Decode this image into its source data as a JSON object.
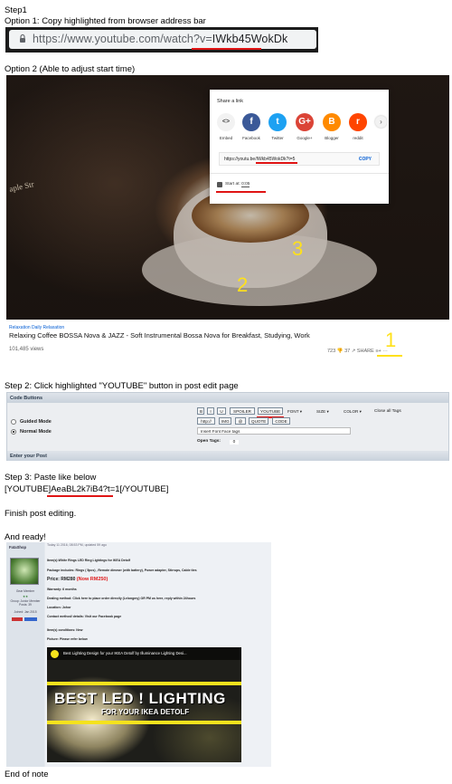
{
  "steps": {
    "step1": "Step1",
    "option1": "Option 1: Copy highlighted from browser address bar",
    "option2": "Option 2 (Able to adjust start time)",
    "step2": "Step 2: Click highlighted \"YOUTUBE\" button in post edit page",
    "step3": "Step 3: Paste like below",
    "paste_prefix": "[YOUTUBE]",
    "paste_id": "AeaBL2k7iB4?t=1",
    "paste_suffix": "[/YOUTUBE]",
    "finish": "Finish post editing.",
    "ready": "And ready!",
    "end": "End of note"
  },
  "addressbar": {
    "url_prefix": "https://www.youtube.com/watch?v=",
    "url_id": "IWkb45WokDk"
  },
  "video1": {
    "subtitle": "Relaxation Daily Relaxation",
    "title": "Relaxing Coffee BOSSA Nova & JAZZ - Soft Instrumental Bossa Nova for Breakfast, Studying, Work",
    "views": "101,485 views",
    "likes": "723   👎 37   ↗ SHARE   ≡+   ···",
    "overlay_text": "aple Str"
  },
  "share": {
    "title": "Share a link",
    "targets": [
      {
        "label": "Embed",
        "glyph": "<>",
        "color": "#f2f2f2"
      },
      {
        "label": "Facebook",
        "glyph": "f",
        "color": "#3b5998"
      },
      {
        "label": "Twitter",
        "glyph": "t",
        "color": "#1da1f2"
      },
      {
        "label": "Google+",
        "glyph": "G+",
        "color": "#db4437"
      },
      {
        "label": "Blogger",
        "glyph": "B",
        "color": "#ff8a00"
      },
      {
        "label": "reddit",
        "glyph": "r",
        "color": "#ff4500"
      }
    ],
    "url": "https://youtu.be/IWkb45WokDk?t=5",
    "copy": "COPY",
    "start_label": "Start at",
    "start_value": "0:05",
    "next": "›"
  },
  "annotations": {
    "n1": "1",
    "n2": "2",
    "n3": "3"
  },
  "editor": {
    "header": "Code Buttons",
    "footer": "Enter your Post",
    "guided": "Guided Mode",
    "normal": "Normal Mode",
    "row1": [
      "B",
      "I",
      "U",
      "SPOILER",
      "YOUTUBE"
    ],
    "font": "FONT",
    "size": "SIZE",
    "color": "COLOR",
    "close_tags": "Close all Tags",
    "row2": [
      "http://",
      "IMG",
      "@",
      "QUOTE",
      "CODE"
    ],
    "field_value": "Insert Font Face tags",
    "open_tags_label": "Open Tags:",
    "open_tags_value": "0"
  },
  "post": {
    "username": "FataShop",
    "header_line": "Today 11 2016, 08:53 PM, updated 59 ago",
    "user_meta": [
      "Gear Member",
      "Group: Junior Member",
      "Posts: 39",
      "Joined: Jan 2015"
    ],
    "lines": [
      "Item(s):White Rings LED Ring Lightings for IKEA Detolf",
      "Package includes: Rings ( 5pcs) , Remote dimmer (with battery), Power adapter, Stirrups, Cable ties",
      "Price: RM280",
      "(Now RM250)",
      "Warranty: 6 months",
      "Dealing method: Click here to place order directly (Lelongmy) OR PM us here, reply within 24hours",
      "Location: Johor",
      "Contact method/ details: Visit our Facebook page",
      "Item(s) conditions: New",
      "Picture: Please refer below"
    ],
    "video_title": "Best Lighting Design for your IKEA Detolf by Illuminance Lighting Desi...",
    "video_big": "BEST LED ! LIGHTING",
    "video_sub": "FOR YOUR IKEA DETOLF"
  }
}
